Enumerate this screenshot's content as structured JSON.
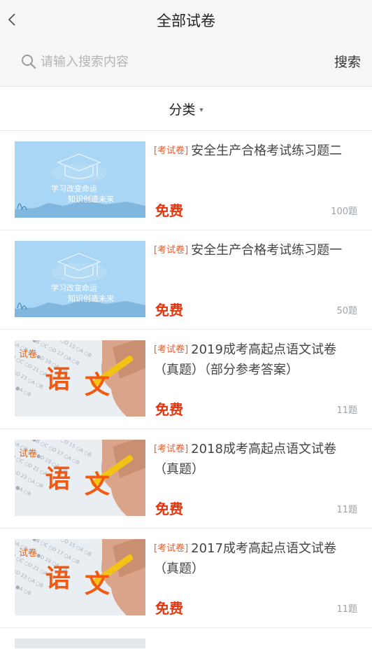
{
  "header": {
    "title": "全部试卷",
    "search_placeholder": "请输入搜索内容",
    "search_button": "搜索"
  },
  "category": {
    "label": "分类"
  },
  "thumbs": {
    "blue": {
      "line1": "学习改变命运",
      "line2": "知识创造未来",
      "bg": "#a9d6f5"
    },
    "chinese": {
      "tag": "试卷",
      "w1": "语",
      "w2": "文",
      "accent": "#f05a12"
    }
  },
  "papers": [
    {
      "tag": "[考试卷]",
      "title_l1": "安全生产合格考试练习题二",
      "title_l2": "",
      "price": "免费",
      "count": "100题",
      "thumb": "blue"
    },
    {
      "tag": "[考试卷]",
      "title_l1": "安全生产合格考试练习题一",
      "title_l2": "",
      "price": "免费",
      "count": "50题",
      "thumb": "blue"
    },
    {
      "tag": "[考试卷]",
      "title_l1": "2019成考高起点语文试卷",
      "title_l2": "（真题）（部分参考答案）",
      "price": "免费",
      "count": "11题",
      "thumb": "chinese"
    },
    {
      "tag": "[考试卷]",
      "title_l1": "2018成考高起点语文试卷",
      "title_l2": "（真题）",
      "price": "免费",
      "count": "11题",
      "thumb": "chinese"
    },
    {
      "tag": "[考试卷]",
      "title_l1": "2017成考高起点语文试卷",
      "title_l2": "（真题）",
      "price": "免费",
      "count": "11题",
      "thumb": "chinese"
    }
  ]
}
